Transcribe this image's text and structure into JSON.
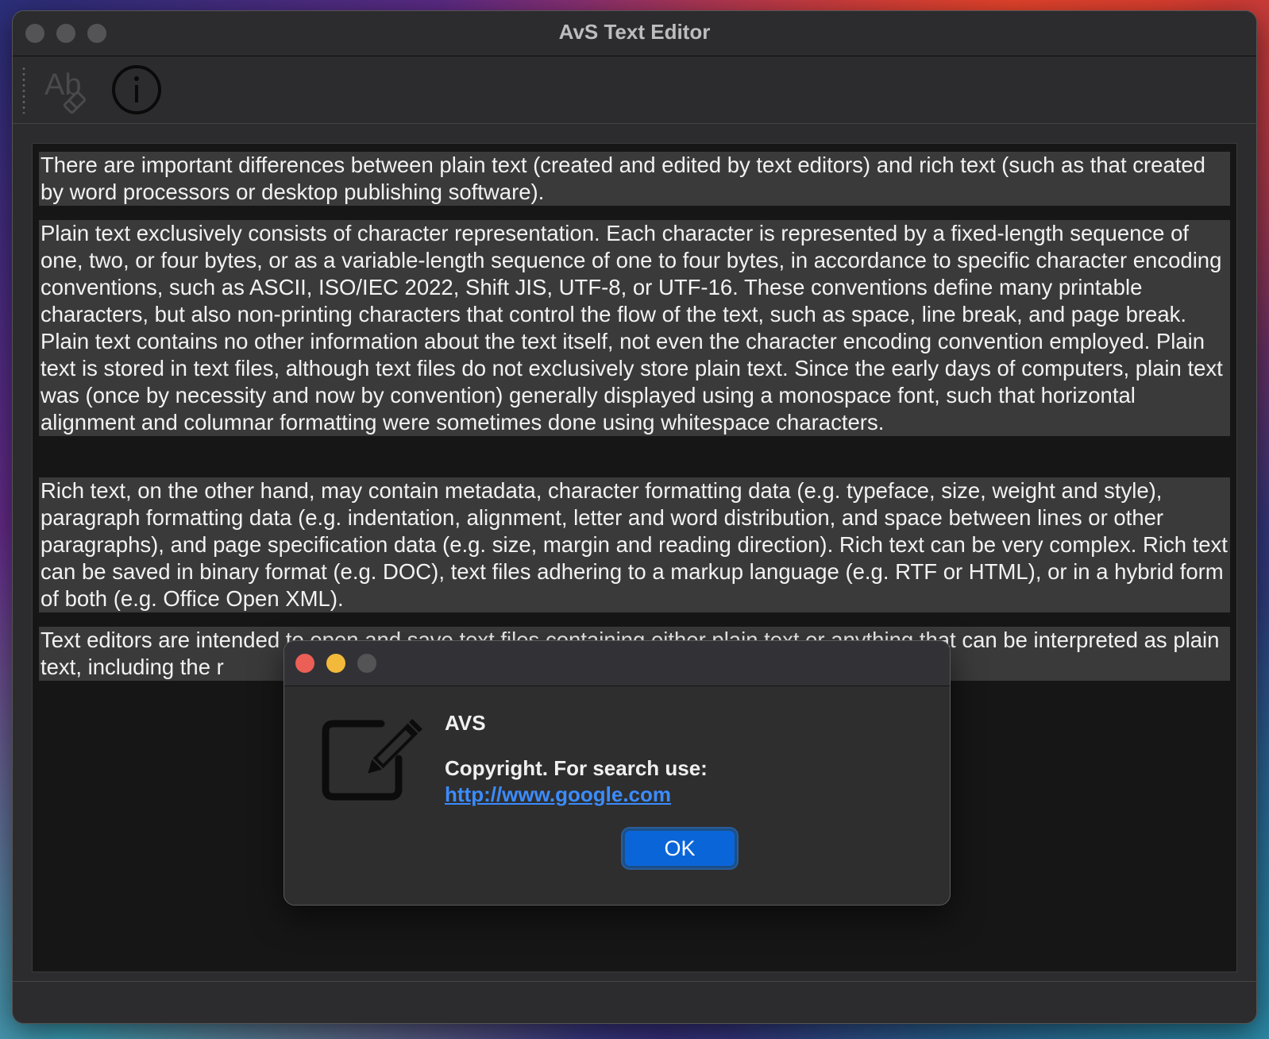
{
  "window": {
    "title": "AvS Text Editor"
  },
  "toolbar": {
    "buttons": [
      {
        "name": "font-style-icon"
      },
      {
        "name": "info-icon"
      }
    ]
  },
  "editor": {
    "paragraphs": [
      "There are important differences between plain text (created and edited by text editors) and rich text (such as that created by word processors or desktop publishing software).",
      "Plain text exclusively consists of character representation. Each character is represented by a fixed-length sequence of one, two, or four bytes, or as a variable-length sequence of one to four bytes, in accordance to specific character encoding conventions, such as ASCII, ISO/IEC 2022, Shift JIS, UTF-8, or UTF-16. These conventions define many printable characters, but also non-printing characters that control the flow of the text, such as space, line break, and page break. Plain text contains no other information about the text itself, not even the character encoding convention employed. Plain text is stored in text files, although text files do not exclusively store plain text. Since the early days of computers, plain text was (once by necessity and now by convention) generally displayed using a monospace font, such that horizontal alignment and columnar formatting were sometimes done using whitespace characters.",
      "Rich text, on the other hand, may contain metadata, character formatting data (e.g. typeface, size, weight and style), paragraph formatting data (e.g. indentation, alignment, letter and word distribution, and space between lines or other paragraphs), and page specification data (e.g. size, margin and reading direction). Rich text can be very complex. Rich text can be saved in binary format (e.g. DOC), text files adhering to a markup language (e.g. RTF or HTML), or in a hybrid form of both (e.g. Office Open XML).",
      "Text editors are intended to open and save text files containing either plain text or anything that can be interpreted as plain text, including the r"
    ]
  },
  "dialog": {
    "heading": "AVS",
    "message_prefix": "Copyright. For search use: ",
    "link_text": "http://www.google.com",
    "ok_label": "OK",
    "icon": "edit-icon"
  },
  "colors": {
    "accent": "#0a66d8",
    "link": "#3b8cff",
    "close": "#ec5f56",
    "minimize": "#f2b93a"
  }
}
